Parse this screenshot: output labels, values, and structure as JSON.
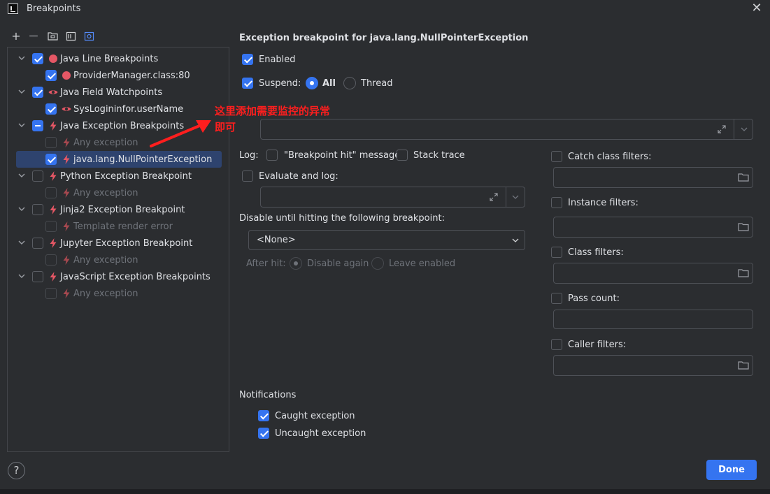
{
  "window": {
    "title": "Breakpoints"
  },
  "toolbar": {
    "add": "+",
    "remove": "—"
  },
  "tree": [
    {
      "label": "Java Line Breakpoints",
      "checked": "on",
      "icon": "red-dot-icon",
      "level": 0,
      "expanded": true
    },
    {
      "label": "ProviderManager.class:80",
      "checked": "on",
      "icon": "red-dot-icon",
      "level": 1
    },
    {
      "label": "Java Field Watchpoints",
      "checked": "on",
      "icon": "eye-icon",
      "level": 0,
      "expanded": true
    },
    {
      "label": "SysLogininfor.userName",
      "checked": "on",
      "icon": "eye-icon",
      "level": 1
    },
    {
      "label": "Java Exception Breakpoints",
      "checked": "mixed",
      "icon": "lightning-icon",
      "level": 0,
      "expanded": true
    },
    {
      "label": "Any exception",
      "checked": "off",
      "icon": "lightning-icon",
      "level": 1,
      "dim": true
    },
    {
      "label": "java.lang.NullPointerException",
      "checked": "on",
      "icon": "lightning-icon",
      "level": 1,
      "selected": true
    },
    {
      "label": "Python Exception Breakpoint",
      "checked": "off",
      "icon": "lightning-icon",
      "level": 0,
      "expanded": true
    },
    {
      "label": "Any exception",
      "checked": "off",
      "icon": "lightning-icon",
      "level": 1,
      "dim": true
    },
    {
      "label": "Jinja2 Exception Breakpoint",
      "checked": "off",
      "icon": "lightning-icon",
      "level": 0,
      "expanded": true
    },
    {
      "label": "Template render error",
      "checked": "off",
      "icon": "lightning-icon",
      "level": 1,
      "dim": true
    },
    {
      "label": "Jupyter Exception Breakpoint",
      "checked": "off",
      "icon": "lightning-icon",
      "level": 0,
      "expanded": true
    },
    {
      "label": "Any exception",
      "checked": "off",
      "icon": "lightning-icon",
      "level": 1,
      "dim": true
    },
    {
      "label": "JavaScript Exception Breakpoints",
      "checked": "off",
      "icon": "lightning-icon",
      "level": 0,
      "expanded": true
    },
    {
      "label": "Any exception",
      "checked": "off",
      "icon": "lightning-icon",
      "level": 1,
      "dim": true
    }
  ],
  "annotation": {
    "text": "这里添加需要监控的异常\n即可",
    "color": "#ff1e1e"
  },
  "details": {
    "heading": "Exception breakpoint for java.lang.NullPointerException",
    "enabled_label": "Enabled",
    "suspend_label": "Suspend:",
    "suspend_all": "All",
    "suspend_thread": "Thread",
    "log_label": "Log:",
    "log_message": "\"Breakpoint hit\" message",
    "log_stack": "Stack trace",
    "evaluate_label": "Evaluate and log:",
    "disable_until_label": "Disable until hitting the following breakpoint:",
    "disable_until_value": "<None>",
    "after_hit_label": "After hit:",
    "after_hit_disable": "Disable again",
    "after_hit_leave": "Leave enabled",
    "notifications_label": "Notifications",
    "caught_exception": "Caught exception",
    "uncaught_exception": "Uncaught exception"
  },
  "filters": {
    "catch_class": "Catch class filters:",
    "instance": "Instance filters:",
    "class": "Class filters:",
    "pass_count": "Pass count:",
    "caller": "Caller filters:"
  },
  "footer": {
    "help": "?",
    "done": "Done"
  },
  "colors": {
    "accent": "#3574f0",
    "background": "#2b2d30",
    "breakpoint_red": "#e55765"
  }
}
